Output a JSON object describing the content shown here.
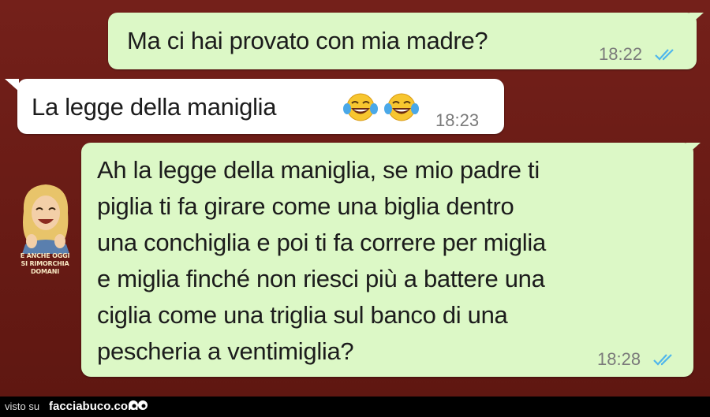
{
  "messages": [
    {
      "direction": "outgoing",
      "text": "Ma ci hai provato con mia madre?",
      "time": "18:22",
      "status": "read-double-check"
    },
    {
      "direction": "incoming",
      "text": "La legge della maniglia",
      "emoji": [
        "tears-of-joy-icon",
        "tears-of-joy-icon"
      ],
      "time": "18:23"
    },
    {
      "direction": "outgoing",
      "lines": [
        "Ah la legge della maniglia, se mio padre ti",
        "piglia ti fa girare come una biglia dentro",
        "una conchiglia e poi ti fa correre per miglia",
        "e miglia finché non riesci più a battere una",
        "ciglia come una triglia sul banco di una",
        "pescheria a ventimiglia?"
      ],
      "time": "18:28",
      "status": "read-double-check"
    }
  ],
  "watermark": {
    "caption_line1": "E ANCHE OGGI",
    "caption_line2": "SI RIMORCHIA DOMANI"
  },
  "footer": {
    "visto_su": "visto su",
    "site": "facciabuco.com"
  },
  "colors": {
    "background": "#6b1b15",
    "outgoing_bubble": "#dcf8c6",
    "incoming_bubble": "#ffffff",
    "read_ticks": "#4fb6ec"
  }
}
